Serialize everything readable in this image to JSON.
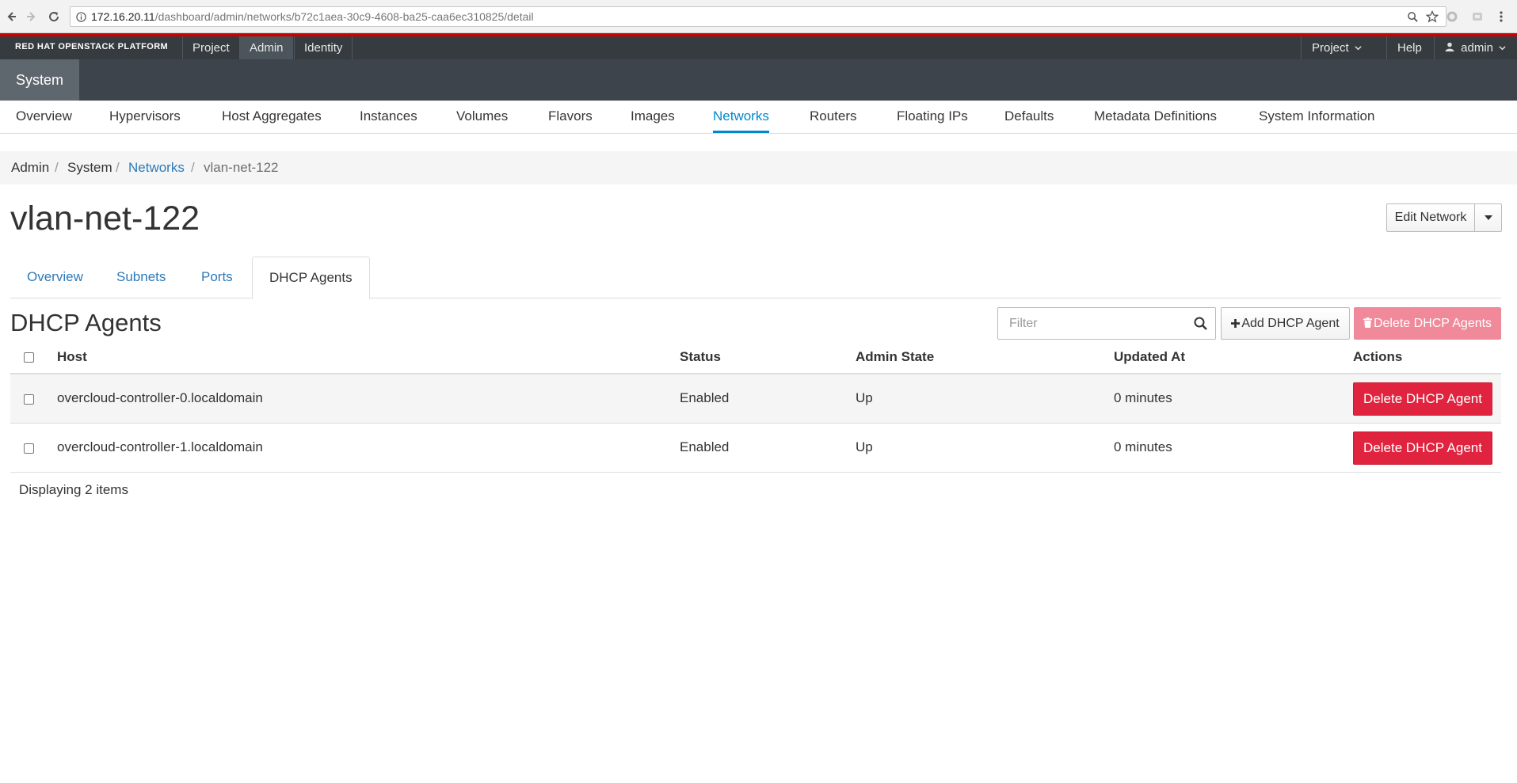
{
  "browser": {
    "url_host": "172.16.20.11",
    "url_path": "/dashboard/admin/networks/b72c1aea-30c9-4608-ba25-caa6ec310825/detail"
  },
  "topnav": {
    "brand": "RED HAT OPENSTACK PLATFORM",
    "items": [
      "Project",
      "Admin",
      "Identity"
    ],
    "active": "Admin",
    "right_project": "Project",
    "right_help": "Help",
    "right_user": "admin"
  },
  "subnav": {
    "system": "System"
  },
  "menu": {
    "items": [
      "Overview",
      "Hypervisors",
      "Host Aggregates",
      "Instances",
      "Volumes",
      "Flavors",
      "Images",
      "Networks",
      "Routers",
      "Floating IPs",
      "Defaults",
      "Metadata Definitions",
      "System Information"
    ],
    "active": "Networks"
  },
  "breadcrumb": {
    "admin": "Admin",
    "system": "System",
    "networks": "Networks",
    "current": "vlan-net-122",
    "sep": "/"
  },
  "page": {
    "title": "vlan-net-122",
    "edit_button": "Edit Network"
  },
  "tabs": {
    "items": [
      "Overview",
      "Subnets",
      "Ports",
      "DHCP Agents"
    ],
    "active": "DHCP Agents"
  },
  "section": {
    "title": "DHCP Agents",
    "filter_placeholder": "Filter",
    "add_button": "Add DHCP Agent",
    "delete_all_button": "Delete DHCP Agents"
  },
  "table": {
    "columns": [
      "Host",
      "Status",
      "Admin State",
      "Updated At",
      "Actions"
    ],
    "rows": [
      {
        "host": "overcloud-controller-0.localdomain",
        "status": "Enabled",
        "admin_state": "Up",
        "updated_at": "0 minutes",
        "action": "Delete DHCP Agent"
      },
      {
        "host": "overcloud-controller-1.localdomain",
        "status": "Enabled",
        "admin_state": "Up",
        "updated_at": "0 minutes",
        "action": "Delete DHCP Agent"
      }
    ],
    "count_text": "Displaying 2 items"
  },
  "colors": {
    "accent": "#0088ce",
    "danger": "#e0243f",
    "danger_disabled": "#f08a9a",
    "topbar": "#363b40",
    "brand_stripe": "#cc0000"
  }
}
